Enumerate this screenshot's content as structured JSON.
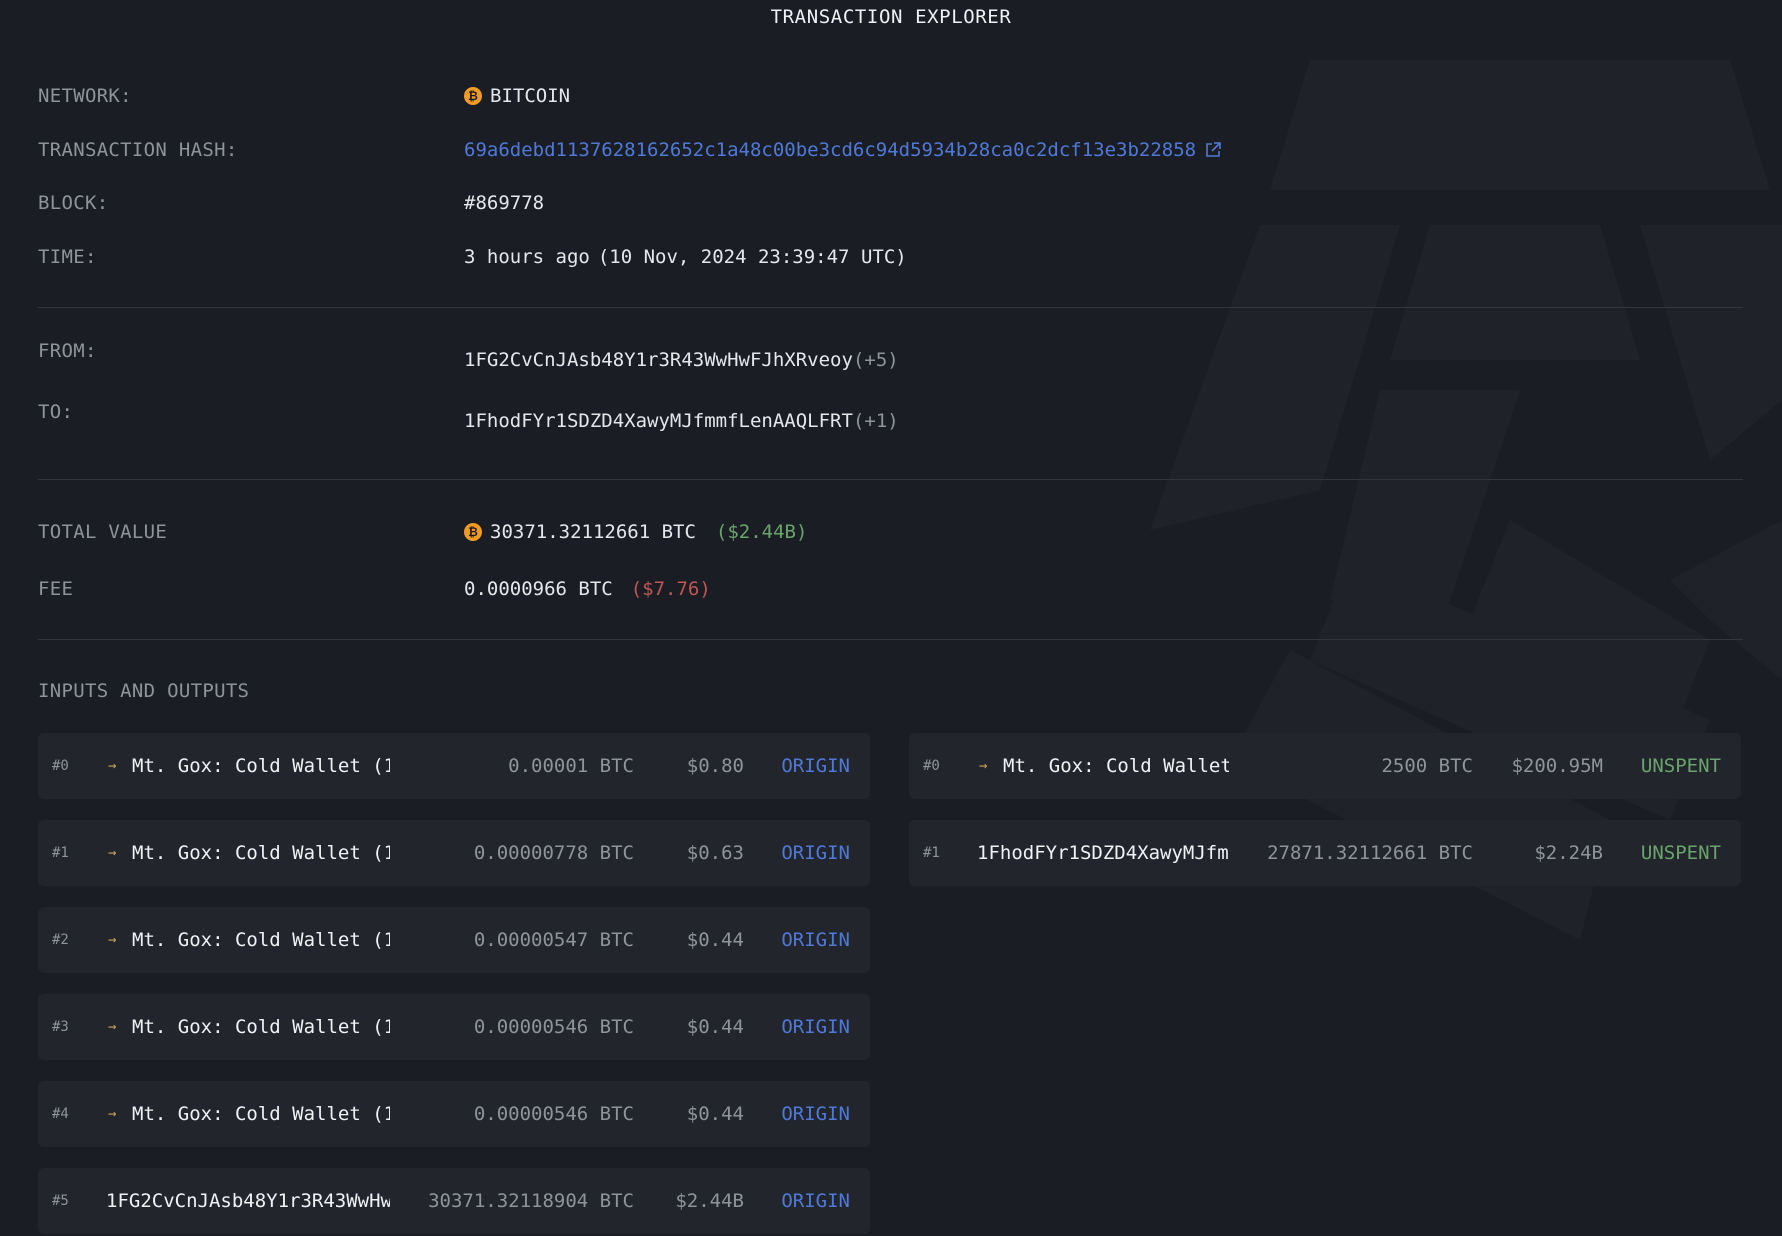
{
  "title": "TRANSACTION EXPLORER",
  "details": {
    "network_label": "NETWORK:",
    "network_value": "BITCOIN",
    "hash_label": "TRANSACTION HASH:",
    "hash_value": "69a6debd1137628162652c1a48c00be3cd6c94d5934b28ca0c2dcf13e3b22858",
    "block_label": "BLOCK:",
    "block_value": "#869778",
    "time_label": "TIME:",
    "time_relative": "3 hours ago",
    "time_absolute": "(10 Nov, 2024 23:39:47 UTC)"
  },
  "parties": {
    "from_label": "FROM:",
    "from_address": "1FG2CvCnJAsb48Y1r3R43WwHwFJhXRveoy",
    "from_extra": "(+5)",
    "to_label": "TO:",
    "to_address": "1FhodFYr1SDZD4XawyMJfmmfLenAAQLFRT",
    "to_extra": "(+1)"
  },
  "totals": {
    "total_label": "TOTAL VALUE",
    "total_btc": "30371.32112661 BTC",
    "total_usd": "($2.44B)",
    "fee_label": "FEE",
    "fee_btc": "0.0000966 BTC",
    "fee_usd": "($7.76)"
  },
  "io_title": "INPUTS AND OUTPUTS",
  "inputs": [
    {
      "index": "#0",
      "entity": true,
      "name": "Mt. Gox: Cold Wallet (1",
      "amount": "0.00001 BTC",
      "usd": "$0.80",
      "status": "ORIGIN"
    },
    {
      "index": "#1",
      "entity": true,
      "name": "Mt. Gox: Cold Wallet (1",
      "amount": "0.00000778 BTC",
      "usd": "$0.63",
      "status": "ORIGIN"
    },
    {
      "index": "#2",
      "entity": true,
      "name": "Mt. Gox: Cold Wallet (1",
      "amount": "0.00000547 BTC",
      "usd": "$0.44",
      "status": "ORIGIN"
    },
    {
      "index": "#3",
      "entity": true,
      "name": "Mt. Gox: Cold Wallet (1",
      "amount": "0.00000546 BTC",
      "usd": "$0.44",
      "status": "ORIGIN"
    },
    {
      "index": "#4",
      "entity": true,
      "name": "Mt. Gox: Cold Wallet (1",
      "amount": "0.00000546 BTC",
      "usd": "$0.44",
      "status": "ORIGIN"
    },
    {
      "index": "#5",
      "entity": false,
      "name": "1FG2CvCnJAsb48Y1r3R43WwHw",
      "amount": "30371.32118904 BTC",
      "usd": "$2.44B",
      "status": "ORIGIN"
    }
  ],
  "outputs": [
    {
      "index": "#0",
      "entity": true,
      "name": "Mt. Gox: Cold Wallet",
      "amount": "2500 BTC",
      "usd": "$200.95M",
      "status": "UNSPENT"
    },
    {
      "index": "#1",
      "entity": false,
      "name": "1FhodFYr1SDZD4XawyMJfm",
      "amount": "27871.32112661 BTC",
      "usd": "$2.24B",
      "status": "UNSPENT"
    }
  ],
  "icons": {
    "btc": "bitcoin-icon",
    "external": "external-link-icon",
    "entity": "entity-arrow-icon"
  },
  "colors": {
    "background": "#1b1d24",
    "card": "#23252d",
    "link": "#4f79d8",
    "positive": "#6aa46d",
    "negative": "#c05653",
    "bitcoin": "#f29b22"
  }
}
